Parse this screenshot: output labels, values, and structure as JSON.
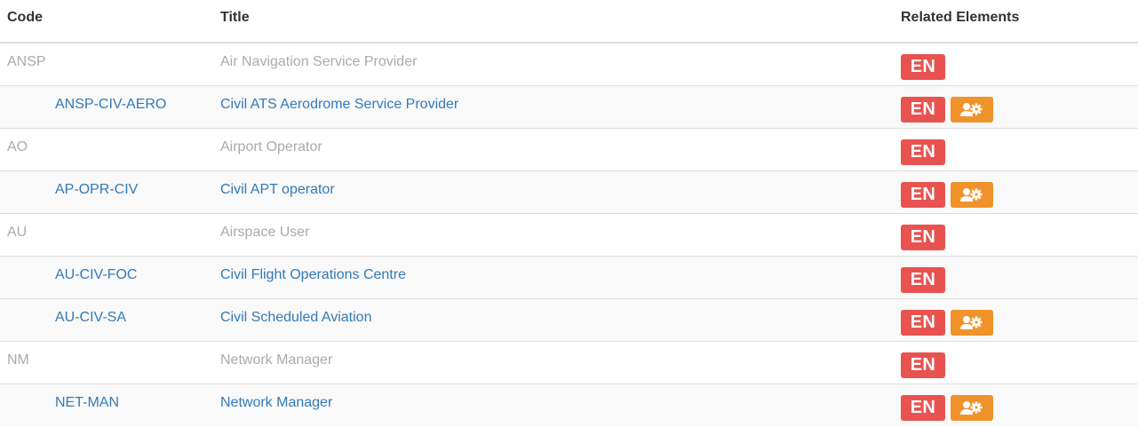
{
  "header": {
    "code": "Code",
    "title": "Title",
    "related": "Related Elements"
  },
  "badges": {
    "en_label": "EN",
    "en_color": "#e8524f",
    "role_icon": "user-gear-icon",
    "role_color": "#f0932b"
  },
  "rows": [
    {
      "code": "ANSP",
      "title": "Air Navigation Service Provider",
      "level": "parent",
      "badges": [
        "EN"
      ]
    },
    {
      "code": "ANSP-CIV-AERO",
      "title": "Civil ATS Aerodrome Service Provider",
      "level": "child",
      "badges": [
        "EN",
        "role"
      ]
    },
    {
      "code": "AO",
      "title": "Airport Operator",
      "level": "parent",
      "badges": [
        "EN"
      ]
    },
    {
      "code": "AP-OPR-CIV",
      "title": "Civil APT operator",
      "level": "child",
      "badges": [
        "EN",
        "role"
      ]
    },
    {
      "code": "AU",
      "title": "Airspace User",
      "level": "parent",
      "badges": [
        "EN"
      ]
    },
    {
      "code": "AU-CIV-FOC",
      "title": "Civil Flight Operations Centre",
      "level": "child",
      "badges": [
        "EN"
      ]
    },
    {
      "code": "AU-CIV-SA",
      "title": "Civil Scheduled Aviation",
      "level": "child",
      "badges": [
        "EN",
        "role"
      ]
    },
    {
      "code": "NM",
      "title": "Network Manager",
      "level": "parent",
      "badges": [
        "EN"
      ]
    },
    {
      "code": "NET-MAN",
      "title": "Network Manager",
      "level": "child",
      "badges": [
        "EN",
        "role"
      ]
    }
  ]
}
